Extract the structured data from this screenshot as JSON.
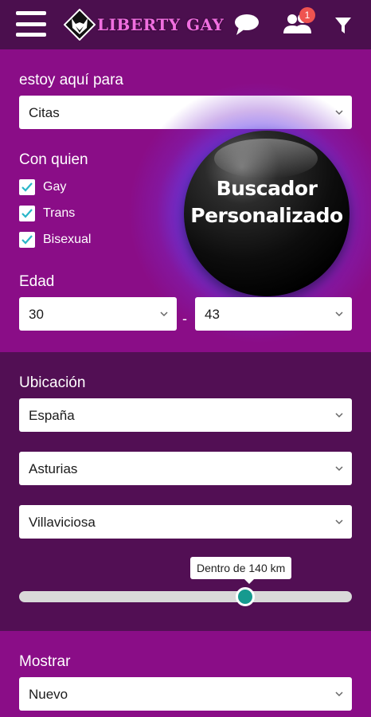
{
  "header": {
    "menu_icon": "hamburger-menu-icon",
    "logo_text": "LIBERTY GAY",
    "chat_icon": "chat-bubble-icon",
    "users_icon": "users-icon",
    "notifications_count": "1",
    "filter_icon": "filter-icon"
  },
  "search": {
    "purpose_label": "estoy aquí para",
    "purpose_value": "Citas",
    "with_whom_label": "Con quien",
    "options": [
      {
        "label": "Gay",
        "checked": true
      },
      {
        "label": "Trans",
        "checked": true
      },
      {
        "label": "Bisexual",
        "checked": true
      }
    ],
    "age_label": "Edad",
    "age_min": "30",
    "age_separator": "-",
    "age_max": "43"
  },
  "promo": {
    "line1": "Buscador",
    "line2": "Personalizado"
  },
  "location": {
    "label": "Ubicación",
    "country": "España",
    "region": "Asturias",
    "city": "Villaviciosa",
    "radius_tooltip": "Dentro de 140 km",
    "radius_km": 140,
    "radius_fraction": 0.68
  },
  "show": {
    "label": "Mostrar",
    "value": "Nuevo"
  },
  "colors": {
    "header_bg": "#4b0f4e",
    "section_light": "#8a0d87",
    "section_dark": "#520f54",
    "accent_teal": "#169a8f",
    "logo_pink": "#f06fe0",
    "badge_red": "#ef5350"
  }
}
